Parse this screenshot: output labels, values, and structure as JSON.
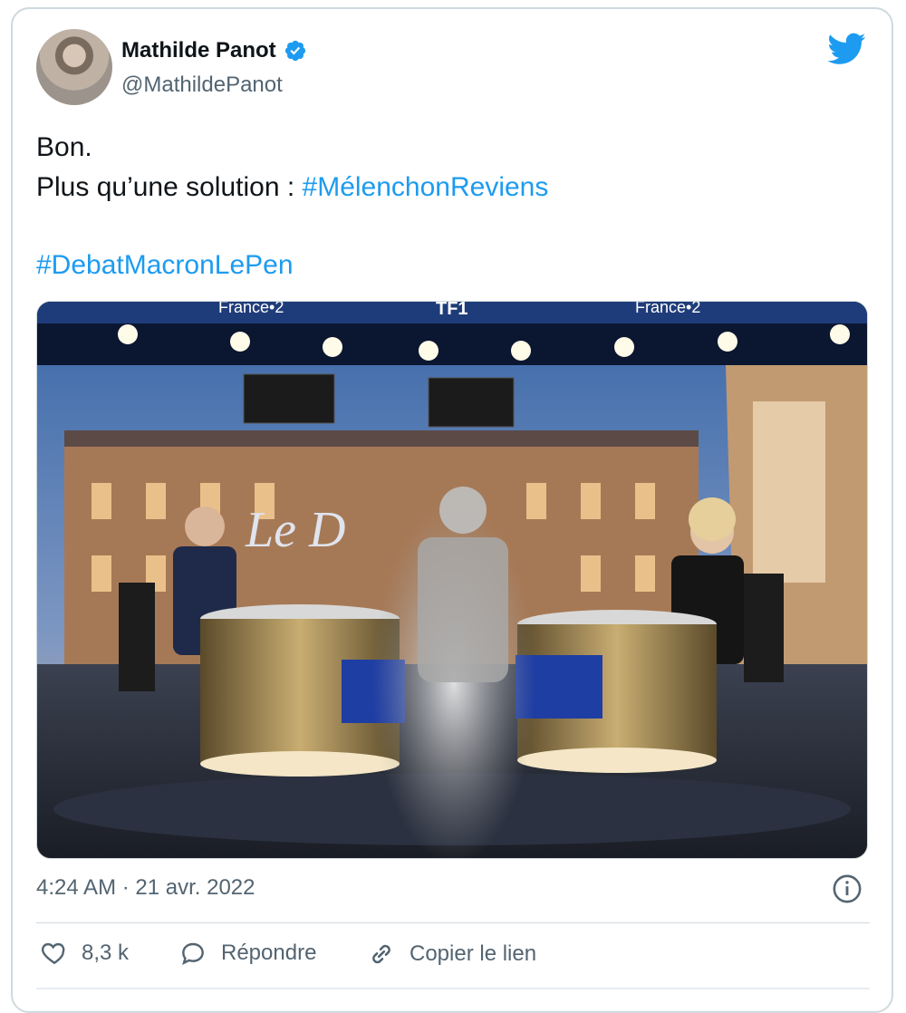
{
  "tweet": {
    "author": {
      "name": "Mathilde Panot",
      "handle": "@MathildePanot",
      "verified": true
    },
    "text": {
      "line1": "Bon.",
      "line2_prefix": "Plus qu’une solution : ",
      "hashtag1": "#MélenchonReviens",
      "hashtag2": "#DebatMacronLePen"
    },
    "media": {
      "banner_left": "France•2",
      "banner_center": "TF1",
      "banner_right": "France•2",
      "set_sign": "Le D"
    },
    "timestamp": "4:24 AM · 21 avr. 2022",
    "actions": {
      "likes": "8,3 k",
      "reply_label": "Répondre",
      "copy_link_label": "Copier le lien"
    }
  },
  "colors": {
    "accent": "#1d9bf0",
    "text": "#0f1419",
    "muted": "#536471",
    "border": "#cfd9de"
  },
  "icons": [
    "verified-badge-icon",
    "twitter-bird-icon",
    "info-icon",
    "heart-icon",
    "reply-icon",
    "link-icon"
  ]
}
